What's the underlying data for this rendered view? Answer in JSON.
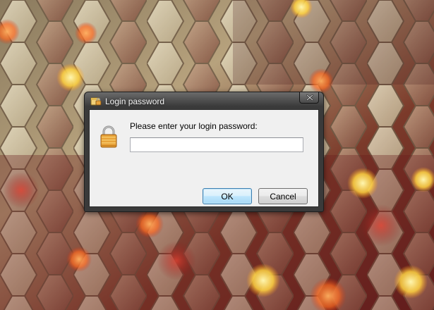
{
  "window": {
    "title": "Login password",
    "close_icon": "close-icon"
  },
  "dialog": {
    "icon": "padlock-icon",
    "prompt": "Please enter your login password:",
    "password_value": "",
    "ok_label": "OK",
    "cancel_label": "Cancel"
  },
  "colors": {
    "dialog_frame": "#3a3a3a",
    "client_background": "#f0f0f0",
    "ok_button": "#bee6fd",
    "padlock": "#e8a33a"
  }
}
